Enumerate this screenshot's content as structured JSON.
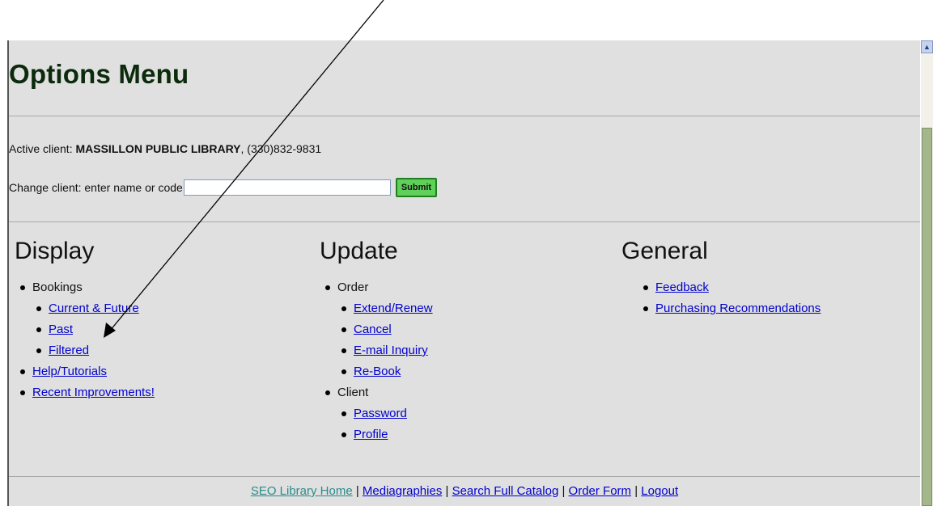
{
  "page": {
    "title": "Options Menu",
    "active_client_label": "Active client:",
    "active_client_name": "MASSILLON PUBLIC LIBRARY",
    "active_client_phone": ", (330)832-9831",
    "change_client_label": "Change client: enter name or code",
    "change_client_value": "",
    "submit_label": "Submit"
  },
  "display": {
    "heading": "Display",
    "bookings_label": "Bookings",
    "bookings_items": [
      "Current & Future",
      "Past",
      "Filtered"
    ],
    "help_label": "Help/Tutorials",
    "improvements_label": "Recent Improvements!"
  },
  "update": {
    "heading": "Update",
    "order_label": "Order",
    "order_items": [
      "Extend/Renew",
      "Cancel",
      "E-mail Inquiry",
      "Re-Book"
    ],
    "client_label": "Client",
    "client_items": [
      "Password",
      "Profile"
    ]
  },
  "general": {
    "heading": "General",
    "items": [
      "Feedback",
      "Purchasing Recommendations"
    ]
  },
  "footer": {
    "links": [
      "SEO Library Home",
      "Mediagraphies",
      "Search Full Catalog",
      "Order Form",
      "Logout"
    ],
    "separator": " | "
  },
  "icons": {
    "scroll_up": "chevron-up-icon",
    "annotation": "arrow-annotation-icon"
  },
  "colors": {
    "background": "#e0e0e0",
    "link": "#0000cc",
    "visited_link": "#2b8a8a",
    "submit_button": "#5fd05a",
    "scroll_thumb": "#a3b78a"
  }
}
